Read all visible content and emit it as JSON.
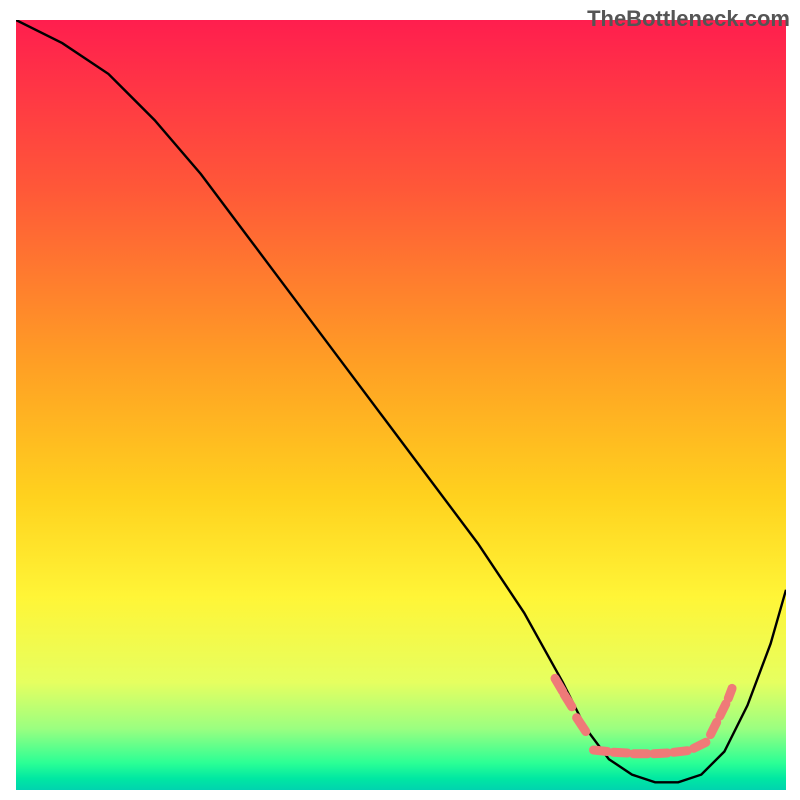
{
  "watermark": "TheBottleneck.com",
  "chart_data": {
    "type": "line",
    "title": "",
    "xlabel": "",
    "ylabel": "",
    "xlim": [
      0,
      100
    ],
    "ylim": [
      0,
      100
    ],
    "background": {
      "type": "vertical_gradient",
      "stops": [
        {
          "offset": 0.0,
          "color": "#ff1e4e"
        },
        {
          "offset": 0.22,
          "color": "#ff5838"
        },
        {
          "offset": 0.45,
          "color": "#ffa024"
        },
        {
          "offset": 0.62,
          "color": "#ffd21e"
        },
        {
          "offset": 0.75,
          "color": "#fff537"
        },
        {
          "offset": 0.86,
          "color": "#e6ff60"
        },
        {
          "offset": 0.92,
          "color": "#9bff80"
        },
        {
          "offset": 0.965,
          "color": "#2bff95"
        },
        {
          "offset": 0.985,
          "color": "#00e8a2"
        },
        {
          "offset": 1.0,
          "color": "#00d3af"
        }
      ]
    },
    "series": [
      {
        "name": "bottleneck_curve",
        "color": "#000000",
        "x": [
          0,
          6,
          12,
          18,
          24,
          30,
          36,
          42,
          48,
          54,
          60,
          66,
          71,
          74,
          77,
          80,
          83,
          86,
          89,
          92,
          95,
          98,
          100
        ],
        "y": [
          100,
          97,
          93,
          87,
          80,
          72,
          64,
          56,
          48,
          40,
          32,
          23,
          14,
          8,
          4,
          2,
          1,
          1,
          2,
          5,
          11,
          19,
          26
        ]
      }
    ],
    "markers": {
      "style": "salmon_dash",
      "color": "#ef7a78",
      "segments": [
        {
          "x0": 70.0,
          "y0": 14.5,
          "x1": 71.0,
          "y1": 12.8
        },
        {
          "x0": 71.2,
          "y0": 12.4,
          "x1": 72.2,
          "y1": 10.8
        },
        {
          "x0": 72.8,
          "y0": 9.4,
          "x1": 74.0,
          "y1": 7.6
        },
        {
          "x0": 75.0,
          "y0": 5.2,
          "x1": 76.8,
          "y1": 5.0
        },
        {
          "x0": 77.6,
          "y0": 4.9,
          "x1": 79.4,
          "y1": 4.8
        },
        {
          "x0": 80.2,
          "y0": 4.7,
          "x1": 82.0,
          "y1": 4.7
        },
        {
          "x0": 82.8,
          "y0": 4.7,
          "x1": 84.6,
          "y1": 4.8
        },
        {
          "x0": 85.4,
          "y0": 4.9,
          "x1": 87.2,
          "y1": 5.1
        },
        {
          "x0": 88.0,
          "y0": 5.4,
          "x1": 89.6,
          "y1": 6.2
        },
        {
          "x0": 90.2,
          "y0": 7.2,
          "x1": 91.0,
          "y1": 8.8
        },
        {
          "x0": 91.4,
          "y0": 9.6,
          "x1": 92.2,
          "y1": 11.2
        },
        {
          "x0": 92.5,
          "y0": 11.9,
          "x1": 93.0,
          "y1": 13.2
        }
      ]
    }
  }
}
